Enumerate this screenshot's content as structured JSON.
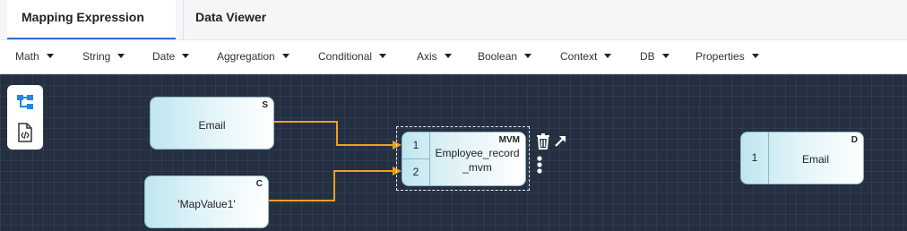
{
  "tabs": [
    {
      "label": "Mapping Expression",
      "active": true
    },
    {
      "label": "Data Viewer",
      "active": false
    }
  ],
  "toolbar": {
    "menus": [
      "Math",
      "String",
      "Date",
      "Aggregation",
      "Conditional",
      "Axis",
      "Boolean",
      "Context",
      "DB",
      "Properties"
    ]
  },
  "canvas": {
    "side_tools": [
      {
        "icon": "hierarchy-tree-icon"
      },
      {
        "icon": "code-file-icon"
      }
    ],
    "nodes": {
      "source_email": {
        "label": "Email",
        "badge": "S"
      },
      "constant": {
        "label": "'MapValue1'",
        "badge": "C"
      },
      "mvm": {
        "label_line1": "Employee_record",
        "label_line2": "_mvm",
        "badge": "MVM",
        "port1": "1",
        "port2": "2"
      },
      "destination": {
        "label": "Email",
        "badge": "D",
        "port": "1"
      }
    },
    "colors": {
      "background": "#243042",
      "wire": "#f0a01e",
      "node_fill": "#bfe6f0"
    }
  }
}
